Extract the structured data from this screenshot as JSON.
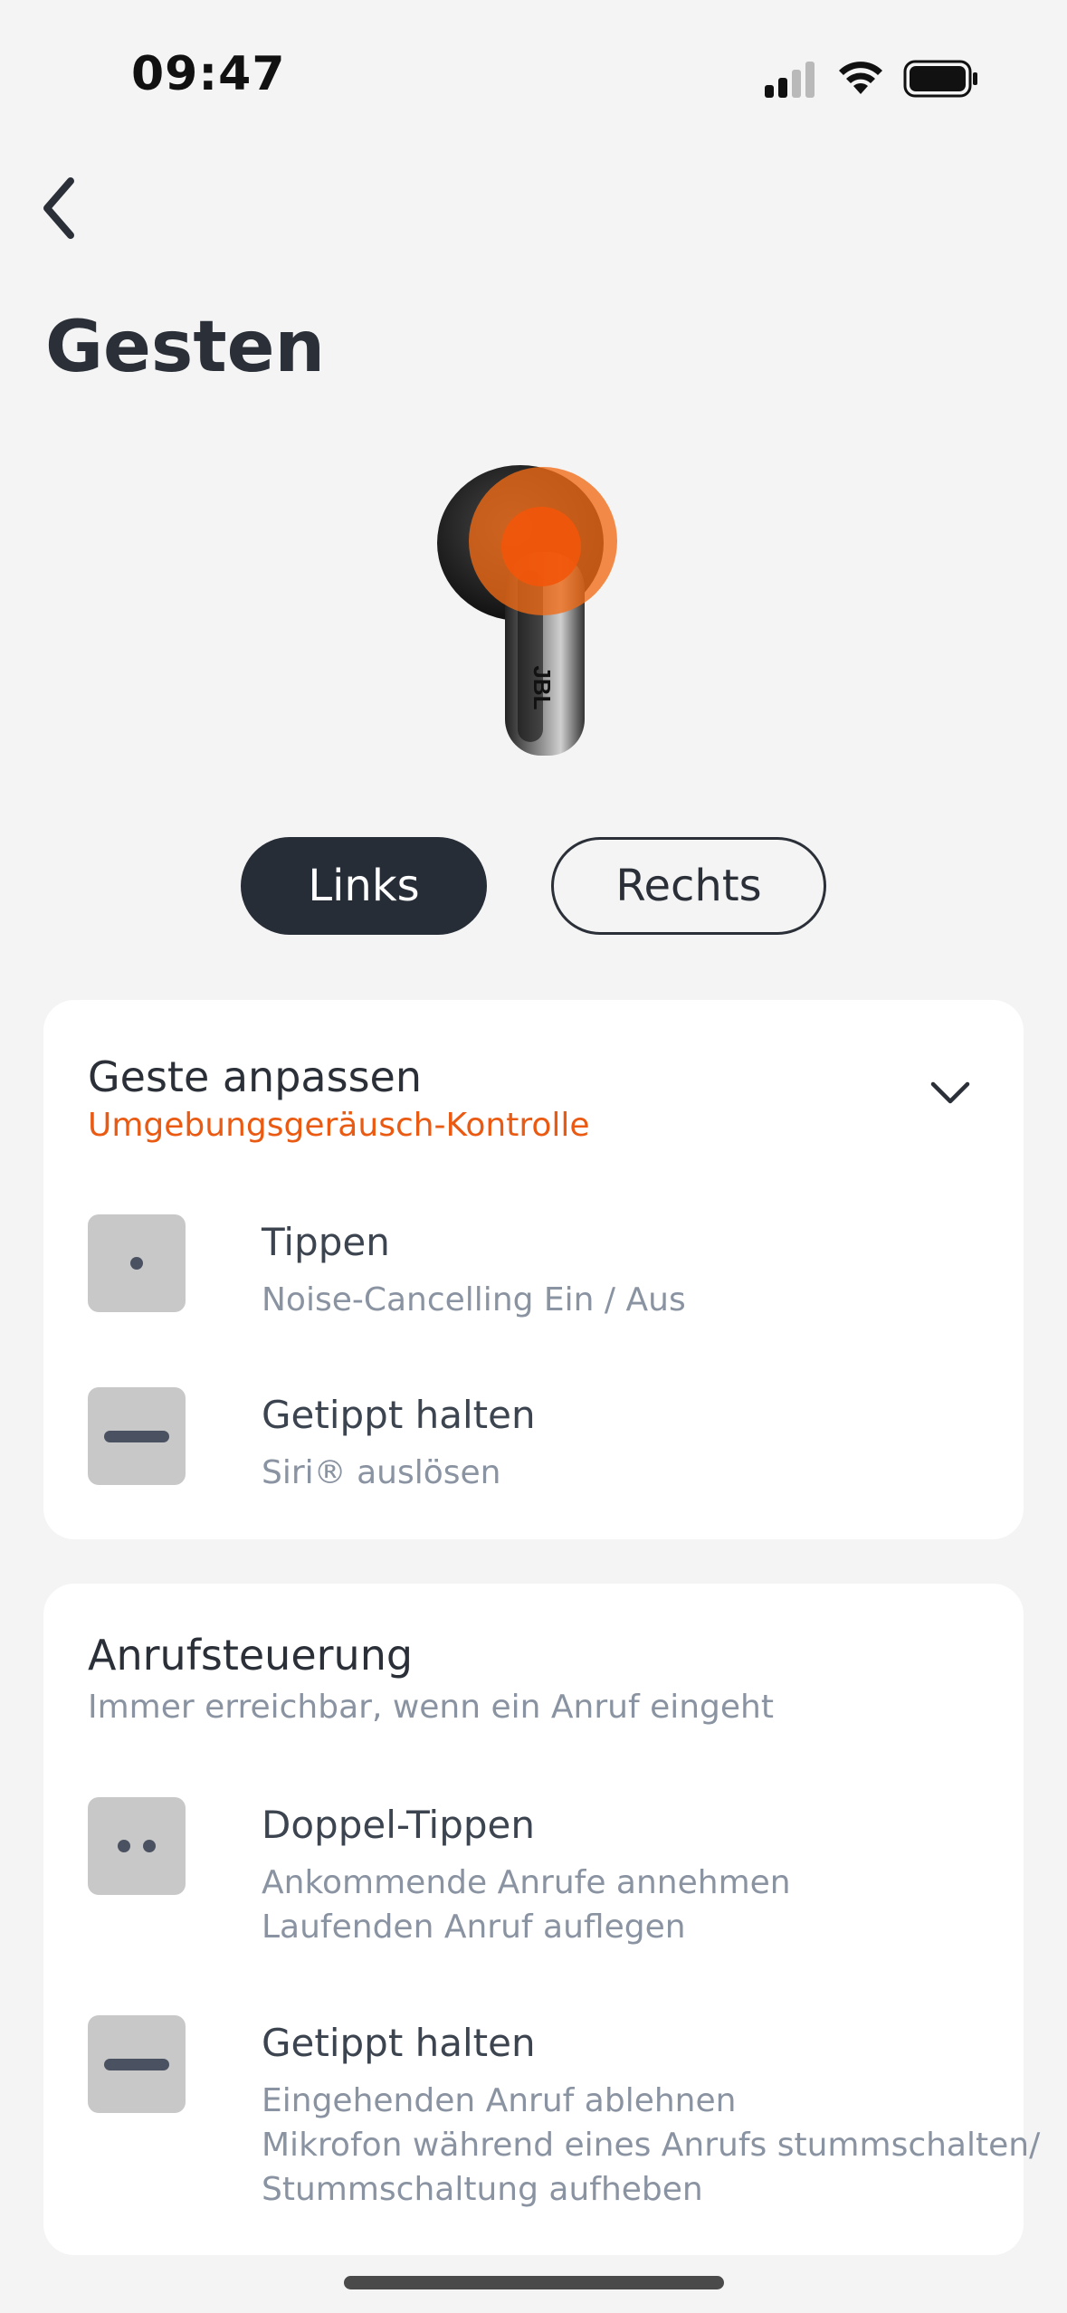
{
  "status_bar": {
    "time": "09:47"
  },
  "header": {
    "title": "Gesten"
  },
  "segment": {
    "left_label": "Links",
    "right_label": "Rechts",
    "selected": "Links"
  },
  "gesture_card": {
    "title": "Geste anpassen",
    "subtitle": "Umgebungsgeräusch-Kontrolle",
    "rows": [
      {
        "title": "Tippen",
        "desc": [
          "Noise-Cancelling Ein / Aus"
        ],
        "icon": "single-dot-icon"
      },
      {
        "title": "Getippt halten",
        "desc": [
          "Siri® auslösen"
        ],
        "icon": "hold-bar-icon"
      }
    ]
  },
  "call_card": {
    "title": "Anrufsteuerung",
    "subtitle": "Immer erreichbar, wenn ein Anruf eingeht",
    "rows": [
      {
        "title": "Doppel-Tippen",
        "desc": [
          "Ankommende Anrufe annehmen",
          "Laufenden Anruf auflegen"
        ],
        "icon": "double-dot-icon"
      },
      {
        "title": "Getippt halten",
        "desc": [
          "Eingehenden Anruf ablehnen",
          "Mikrofon während eines Anrufs stummschalten/",
          "Stummschaltung aufheben"
        ],
        "icon": "hold-bar-icon"
      }
    ]
  },
  "earbud": {
    "brand": "JBL"
  },
  "colors": {
    "accent": "#ea5a12",
    "dark": "#262d37",
    "background": "#f4f4f4"
  }
}
